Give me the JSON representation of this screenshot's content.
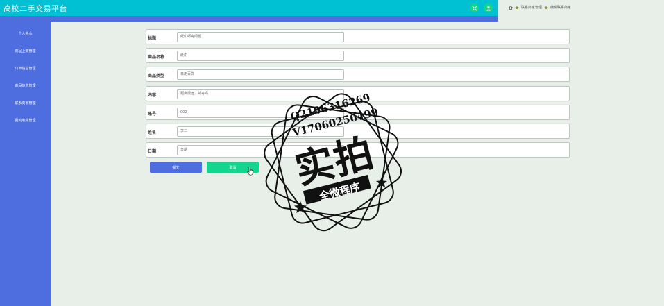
{
  "header": {
    "app_title": "高校二手交易平台"
  },
  "breadcrumb": {
    "items": [
      "联系商家管理",
      "编辑联系商家"
    ]
  },
  "sidebar": {
    "items": [
      {
        "label": "个人中心"
      },
      {
        "label": "商品上架管理"
      },
      {
        "label": "订单信息管理"
      },
      {
        "label": "商品信息管理"
      },
      {
        "label": "联系商家管理"
      },
      {
        "label": "我的收藏管理"
      }
    ]
  },
  "form": {
    "fields": [
      {
        "label": "标题",
        "value": "纸巾邮寄问题"
      },
      {
        "label": "商品名称",
        "value": "纸巾"
      },
      {
        "label": "商品类型",
        "value": "日用百货"
      },
      {
        "label": "内容",
        "value": "距离很远，邮寄吗"
      },
      {
        "label": "账号",
        "value": "002"
      },
      {
        "label": "姓名",
        "value": "李二"
      },
      {
        "label": "日期",
        "value": "日期"
      }
    ],
    "submit_label": "提交",
    "cancel_label": "取消"
  },
  "watermark": {
    "line1": "Q2196316269",
    "line2": "V17060256499",
    "main": "实拍",
    "banner": "全微程序"
  },
  "colors": {
    "header": "#00c1d4",
    "sidebar": "#4e6ee0",
    "submit": "#4e6ee0",
    "cancel": "#12d58f",
    "background": "#e8efe9"
  },
  "icons": {
    "header_button_1": "fullscreen-icon",
    "header_button_2": "user-icon",
    "breadcrumb_home": "home-icon",
    "breadcrumb_separator": "star-icon"
  }
}
